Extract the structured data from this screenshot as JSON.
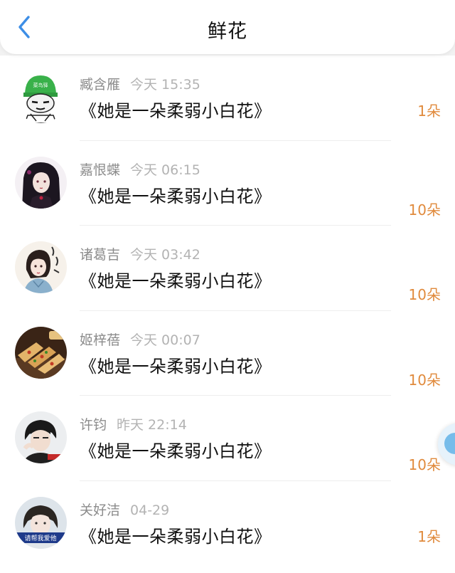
{
  "header": {
    "title": "鲜花",
    "back_icon": "chevron-left-icon",
    "accent_color": "#3d8ee6"
  },
  "colors": {
    "count_color": "#e08a3c",
    "name_color": "#8c8c8c",
    "time_color": "#b3b3b3"
  },
  "records": [
    {
      "name": "臧含雁",
      "time": "今天 15:35",
      "gift": "《她是一朵柔弱小白花》",
      "count": "1朵"
    },
    {
      "name": "嘉恨蝶",
      "time": "今天 06:15",
      "gift": "《她是一朵柔弱小白花》",
      "count": "10朵"
    },
    {
      "name": "诸葛吉",
      "time": "今天 03:42",
      "gift": "《她是一朵柔弱小白花》",
      "count": "10朵"
    },
    {
      "name": "姬梓蓓",
      "time": "今天 00:07",
      "gift": "《她是一朵柔弱小白花》",
      "count": "10朵"
    },
    {
      "name": "许钧",
      "time": "昨天 22:14",
      "gift": "《她是一朵柔弱小白花》",
      "count": "10朵"
    },
    {
      "name": "关好洁",
      "time": "04-29",
      "gift": "《她是一朵柔弱小白花》",
      "count": "1朵"
    }
  ],
  "avatar_texts": {
    "helmet": "菜鸟驿",
    "banner": "请帮我爱他"
  }
}
